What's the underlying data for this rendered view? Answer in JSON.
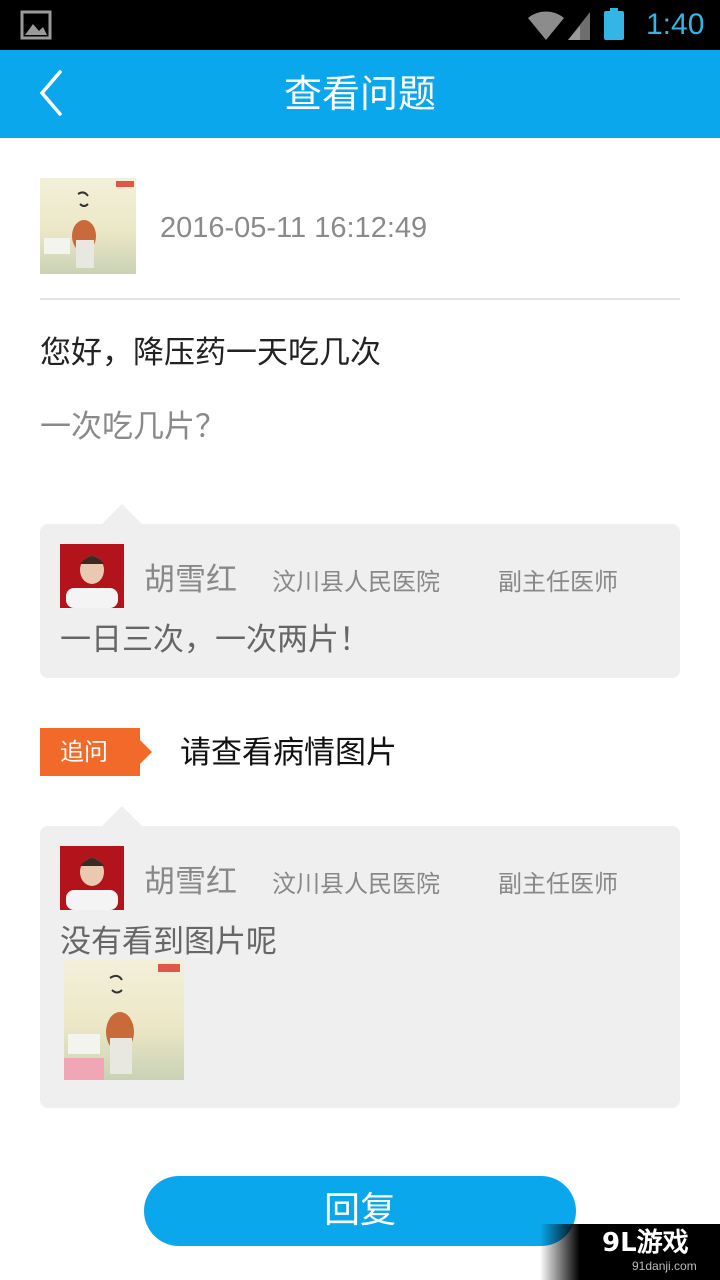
{
  "status_bar": {
    "time": "1:40",
    "icons": [
      "image-notification-icon",
      "wifi-icon",
      "signal-icon",
      "battery-icon"
    ],
    "accent_color": "#33b5e5"
  },
  "header": {
    "title": "查看问题",
    "back_icon": "chevron-left-icon",
    "background_color": "#0ba7ec"
  },
  "question": {
    "timestamp": "2016-05-11 16:12:49",
    "title": "您好，降压药一天吃几次",
    "detail": "一次吃几片？"
  },
  "replies": [
    {
      "doctor_name": "胡雪红",
      "hospital": "汶川县人民医院",
      "rank": "副主任医师",
      "text": "一日三次，一次两片！"
    },
    {
      "doctor_name": "胡雪红",
      "hospital": "汶川县人民医院",
      "rank": "副主任医师",
      "text": "没有看到图片呢"
    }
  ],
  "followup": {
    "tag_label": "追问",
    "text": "请查看病情图片",
    "tag_color": "#f26a2a"
  },
  "footer": {
    "reply_button_label": "回复"
  },
  "watermark": {
    "main": "9L游戏",
    "sub": "91danji.com"
  }
}
